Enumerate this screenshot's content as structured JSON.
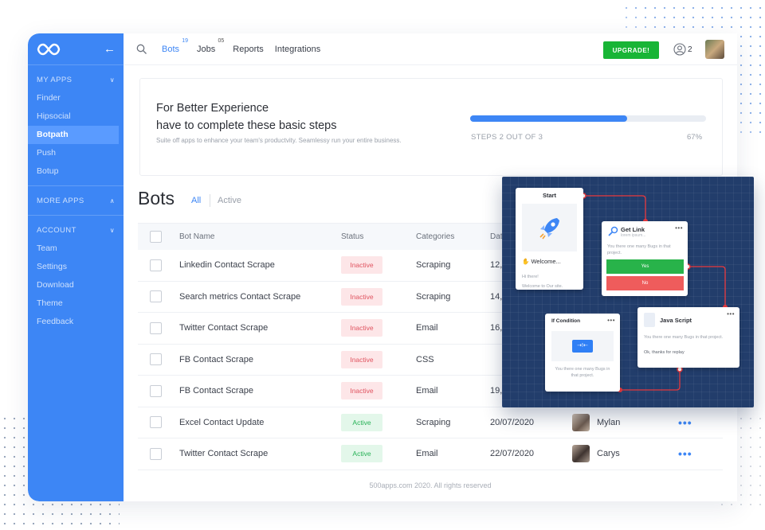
{
  "sidebar": {
    "sections": [
      {
        "title": "MY APPS",
        "items": [
          "Finder",
          "Hipsocial",
          "Botpath",
          "Push",
          "Botup"
        ],
        "active": "Botpath"
      },
      {
        "title": "MORE APPS",
        "items": []
      },
      {
        "title": "ACCOUNT",
        "items": [
          "Team",
          "Settings",
          "Download",
          "Theme",
          "Feedback"
        ]
      }
    ]
  },
  "topbar": {
    "nav": [
      {
        "label": "Bots",
        "badge": "19"
      },
      {
        "label": "Jobs",
        "badge": "05"
      },
      {
        "label": "Reports"
      },
      {
        "label": "Integrations"
      }
    ],
    "upgrade_label": "UPGRADE!",
    "users_count": "2"
  },
  "promo": {
    "title": "For Better Experience\nhave to complete these basic steps",
    "subtitle": "Suite off apps to enhance your team's productvity. Seamlessy run your entire business.",
    "progress": 0.67,
    "steps_label": "STEPS 2 OUT OF 3",
    "percent_label": "67%"
  },
  "bots": {
    "title": "Bots",
    "tabs": [
      "All",
      "Active"
    ],
    "columns": [
      "Bot Name",
      "Status",
      "Categories",
      "Dat"
    ],
    "rows": [
      {
        "name": "Linkedin Contact Scrape",
        "status": "Inactive",
        "category": "Scraping",
        "date": "12,",
        "owner": ""
      },
      {
        "name": "Search metrics Contact Scrape",
        "status": "Inactive",
        "category": "Scraping",
        "date": "14,",
        "owner": ""
      },
      {
        "name": "Twitter Contact Scrape",
        "status": "Inactive",
        "category": "Email",
        "date": "16,",
        "owner": ""
      },
      {
        "name": "FB Contact Scrape",
        "status": "Inactive",
        "category": "CSS",
        "date": "",
        "owner": ""
      },
      {
        "name": "FB Contact Scrape",
        "status": "Inactive",
        "category": "Email",
        "date": "19,",
        "owner": ""
      },
      {
        "name": "Excel Contact Update",
        "status": "Active",
        "category": "Scraping",
        "date": "20/07/2020",
        "owner": "Mylan"
      },
      {
        "name": "Twitter Contact Scrape",
        "status": "Active",
        "category": "Email",
        "date": "22/07/2020",
        "owner": "Carys"
      }
    ]
  },
  "footer": "500apps.com 2020. All rights reserved",
  "flow": {
    "start": {
      "title": "Start",
      "welcome": "Welcome...",
      "text1": "Hi there!",
      "text2": "Welcome to Our site."
    },
    "get_link": {
      "title": "Get Link",
      "sub": "lorem ipsum...",
      "desc": "You there one many Bugs in that project.",
      "yes": "Yes",
      "no": "No"
    },
    "java_script": {
      "title": "Java Script",
      "desc": "You there one many Bugs in that project.",
      "reply": "Ok, thanks for replay"
    },
    "if_condition": {
      "title": "If Condition",
      "chip": "⇢!⇠",
      "desc": "You there one many Bugs in that project."
    }
  },
  "colors": {
    "brand": "#3d86f5",
    "upgrade": "#18b536",
    "inactive": "#e0535f",
    "active": "#27b156"
  }
}
